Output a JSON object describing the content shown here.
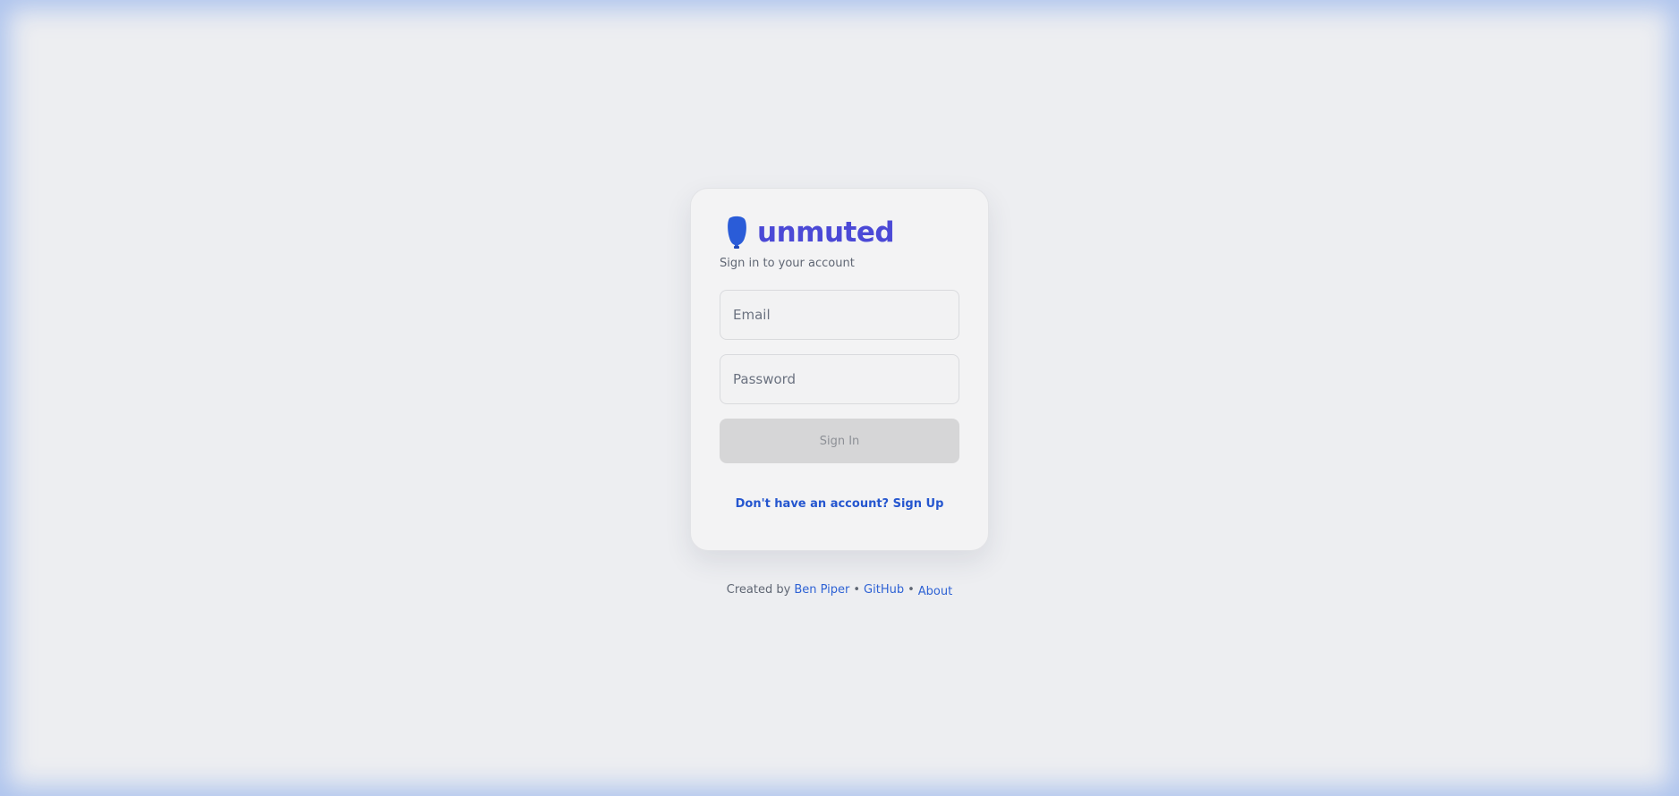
{
  "brand": {
    "name": "unmuted",
    "logo_icon": "microphone-icon",
    "color": "#4b49d6"
  },
  "login": {
    "subtitle": "Sign in to your account",
    "email_placeholder": "Email",
    "password_placeholder": "Password",
    "signin_label": "Sign In",
    "signup_label": "Don't have an account? Sign Up"
  },
  "footer": {
    "created_by": "Created by",
    "author": "Ben Piper",
    "separator": "•",
    "github": "GitHub",
    "about": "About"
  },
  "colors": {
    "link": "#2556cf",
    "background": "#edeef1",
    "card": "#f3f3f4",
    "button_disabled": "#d6d6d7"
  }
}
